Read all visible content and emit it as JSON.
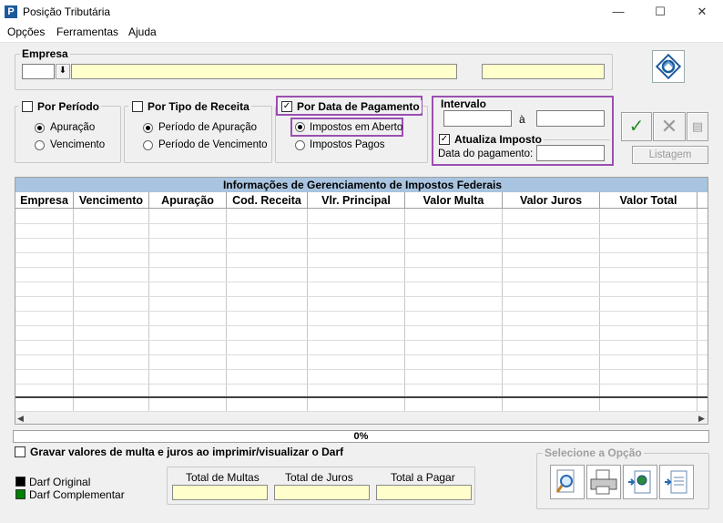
{
  "window": {
    "title": "Posição Tributária",
    "minimize": "—",
    "maximize": "☐",
    "close": "✕"
  },
  "menu": [
    "Opções",
    "Ferramentas",
    "Ajuda"
  ],
  "empresa": {
    "label": "Empresa",
    "code": "",
    "name": "",
    "extra": ""
  },
  "periodo": {
    "label": "Por Período",
    "checked": false,
    "options": [
      "Apuração",
      "Vencimento"
    ],
    "selected": 0
  },
  "tipo_receita": {
    "label": "Por Tipo de Receita",
    "checked": false,
    "options": [
      "Período de Apuração",
      "Período de Vencimento"
    ],
    "selected": 0
  },
  "data_pagamento": {
    "label": "Por Data de Pagamento",
    "checked": true,
    "options": [
      "Impostos em Aberto",
      "Impostos Pagos"
    ],
    "selected": 0
  },
  "intervalo": {
    "label": "Intervalo",
    "sep": "à",
    "from": "",
    "to": ""
  },
  "atualiza": {
    "label": "Atualiza Imposto",
    "checked": true,
    "date_label": "Data do pagamento:",
    "date": ""
  },
  "actions": {
    "listagem": "Listagem"
  },
  "grid": {
    "title": "Informações de Gerenciamento de Impostos Federais",
    "columns": [
      "Empresa",
      "Vencimento",
      "Apuração",
      "Cod. Receita",
      "Vlr. Principal",
      "Valor Multa",
      "Valor Juros",
      "Valor Total"
    ]
  },
  "progress": {
    "value": "0%",
    "fraction": 0
  },
  "gravar": {
    "label": "Gravar valores de multa e juros ao imprimir/visualizar o Darf",
    "checked": false
  },
  "legend": [
    {
      "label": "Darf Original",
      "color": "#000000"
    },
    {
      "label": "Darf Complementar",
      "color": "#008000"
    }
  ],
  "totals": {
    "multas_label": "Total de Multas",
    "juros_label": "Total de Juros",
    "pagar_label": "Total a Pagar",
    "multas": "",
    "juros": "",
    "pagar": ""
  },
  "opcao": {
    "label": "Selecione a Opção"
  }
}
